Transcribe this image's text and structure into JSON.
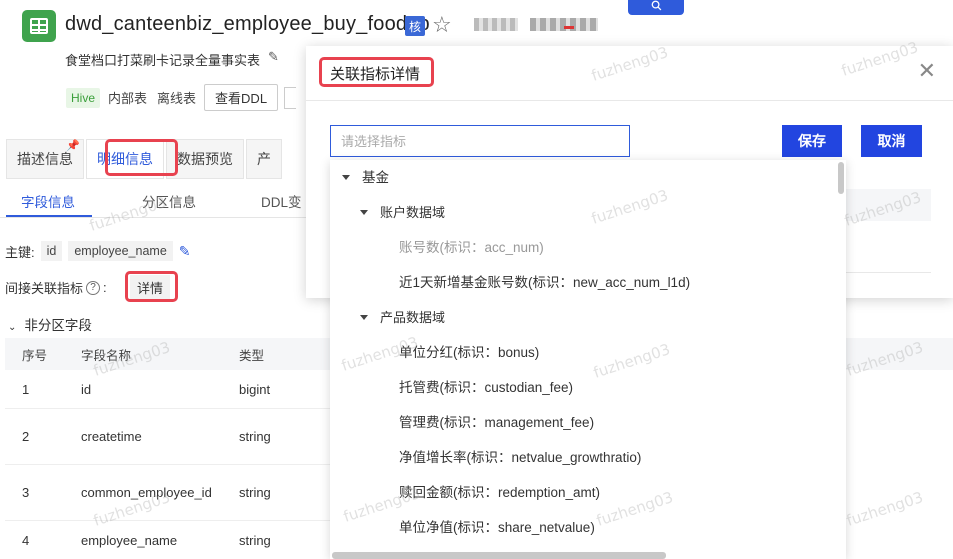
{
  "header": {
    "title": "dwd_canteenbiz_employee_buy_food_p",
    "core_badge": "核",
    "subtitle": "食堂档口打菜刷卡记录全量事实表",
    "tags": [
      "Hive",
      "内部表",
      "离线表"
    ],
    "ddl_button": "查看DDL"
  },
  "main_tabs": [
    "描述信息",
    "明细信息",
    "数据预览",
    "产"
  ],
  "sub_tabs": [
    "字段信息",
    "分区信息",
    "DDL变"
  ],
  "primary_key": {
    "label": "主键:",
    "values": [
      "id",
      "employee_name"
    ]
  },
  "indirect_indicator": {
    "label": "间接关联指标",
    "detail_button": "详情"
  },
  "section_title": "非分区字段",
  "columns_table": {
    "headers": [
      "序号",
      "字段名称",
      "类型"
    ],
    "rows": [
      {
        "no": "1",
        "name": "id",
        "type": "bigint"
      },
      {
        "no": "2",
        "name": "createtime",
        "type": "string"
      },
      {
        "no": "3",
        "name": "common_employee_id",
        "type": "string"
      },
      {
        "no": "4",
        "name": "employee_name",
        "type": "string"
      }
    ]
  },
  "modal": {
    "title": "关联指标详情",
    "select_placeholder": "请选择指标",
    "save_label": "保存",
    "cancel_label": "取消"
  },
  "tree": {
    "root": "基金",
    "groups": [
      {
        "label": "账户数据域",
        "items": [
          {
            "label": "账号数(标识：acc_num)",
            "disabled": true
          },
          {
            "label": "近1天新增基金账号数(标识：new_acc_num_l1d)",
            "disabled": false
          }
        ]
      },
      {
        "label": "产品数据域",
        "items": [
          {
            "label": "单位分红(标识：bonus)",
            "disabled": false
          },
          {
            "label": "托管费(标识：custodian_fee)",
            "disabled": false
          },
          {
            "label": "管理费(标识：management_fee)",
            "disabled": false
          },
          {
            "label": "净值增长率(标识：netvalue_growthratio)",
            "disabled": false
          },
          {
            "label": "赎回金额(标识：redemption_amt)",
            "disabled": false
          },
          {
            "label": "单位净值(标识：share_netvalue)",
            "disabled": false
          }
        ]
      }
    ]
  },
  "watermark": "fuzheng03"
}
